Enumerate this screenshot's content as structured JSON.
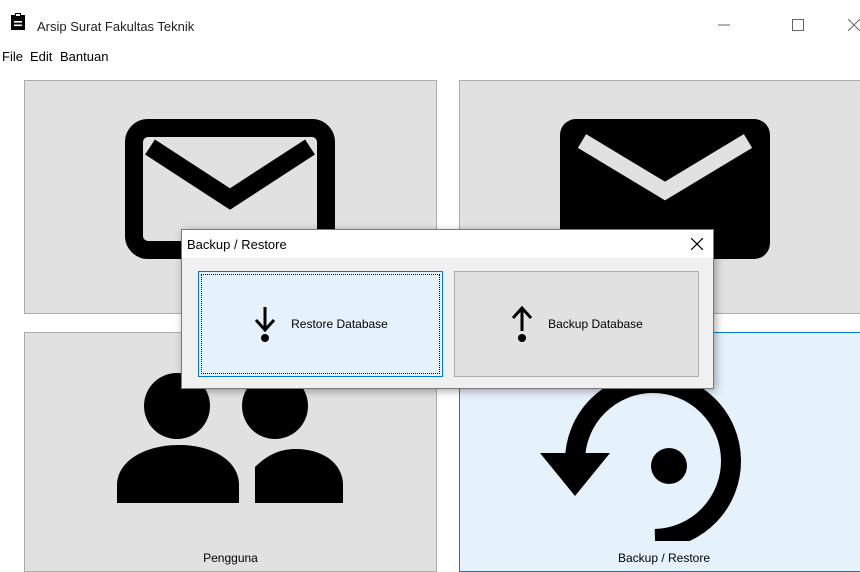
{
  "window": {
    "title": "Arsip Surat Fakultas Teknik",
    "app_icon": "clipboard-icon",
    "controls": {
      "minimize": "—",
      "maximize": "☐",
      "close": "✕"
    }
  },
  "menubar": {
    "items": [
      "File",
      "Edit",
      "Bantuan"
    ]
  },
  "tiles": [
    {
      "icon": "mail-outline-icon",
      "label": ""
    },
    {
      "icon": "mail-filled-icon",
      "label": ""
    },
    {
      "icon": "users-icon",
      "label": "Pengguna"
    },
    {
      "icon": "restore-icon",
      "label": "Backup / Restore"
    }
  ],
  "dialog": {
    "title": "Backup / Restore",
    "close": "✕",
    "buttons": [
      {
        "label": "Restore Database",
        "icon": "arrow-down-icon"
      },
      {
        "label": "Backup Database",
        "icon": "arrow-up-icon"
      }
    ]
  },
  "colors": {
    "tile_bg": "#e1e1e1",
    "tile_border": "#adadad",
    "selected_bg": "#e5f1fb",
    "accent": "#0078d7",
    "dialog_bg": "#f0f0f0"
  }
}
